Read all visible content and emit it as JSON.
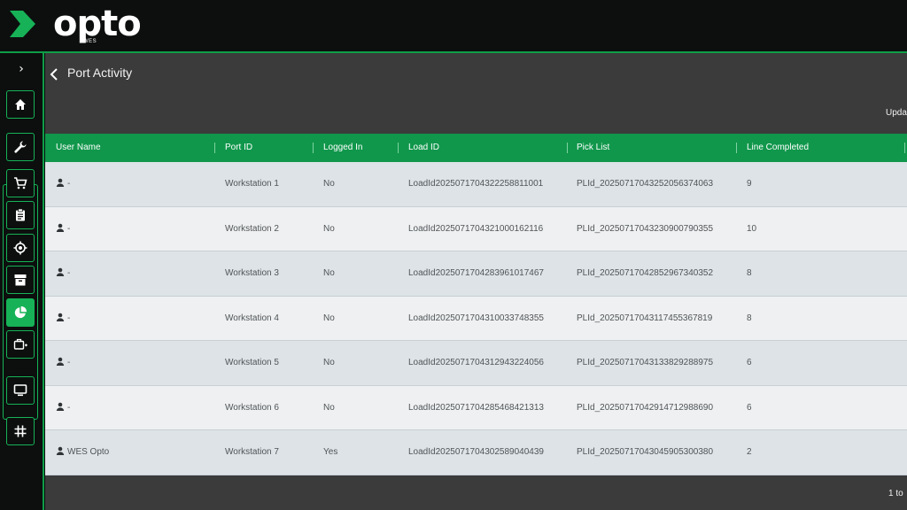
{
  "app": {
    "logo_text": "opto",
    "logo_subtext": "WES",
    "accent": "#17b257",
    "header_green": "#10974b"
  },
  "sidebar": {
    "expand_icon": "chevron-right-icon",
    "items": [
      {
        "name": "home",
        "icon": "home-icon"
      },
      {
        "name": "tools",
        "icon": "wrench-icon"
      },
      {
        "name": "orders",
        "icon": "cart-icon"
      },
      {
        "name": "tasks",
        "icon": "clipboard-icon"
      },
      {
        "name": "locations",
        "icon": "target-icon"
      },
      {
        "name": "storage",
        "icon": "archive-icon"
      },
      {
        "name": "reports",
        "icon": "pie-chart-icon",
        "active": true
      },
      {
        "name": "transfer",
        "icon": "box-arrow-icon"
      },
      {
        "name": "monitor",
        "icon": "monitor-icon"
      },
      {
        "name": "grid",
        "icon": "grid-icon"
      }
    ]
  },
  "page": {
    "title": "Port Activity",
    "update_label": "Upda",
    "footer_text": "1 to"
  },
  "table": {
    "columns": [
      "User Name",
      "Port ID",
      "Logged In",
      "Load ID",
      "Pick List",
      "Line Completed"
    ],
    "rows": [
      {
        "user": "-",
        "port": "Workstation 1",
        "logged_in": "No",
        "load_id": "LoadId2025071704322258811001",
        "pick_list": "PLId_20250717043252056374063",
        "lines": "9"
      },
      {
        "user": "-",
        "port": "Workstation 2",
        "logged_in": "No",
        "load_id": "LoadId2025071704321000162116",
        "pick_list": "PLId_20250717043230900790355",
        "lines": "10"
      },
      {
        "user": "-",
        "port": "Workstation 3",
        "logged_in": "No",
        "load_id": "LoadId2025071704283961017467",
        "pick_list": "PLId_20250717042852967340352",
        "lines": "8"
      },
      {
        "user": "-",
        "port": "Workstation 4",
        "logged_in": "No",
        "load_id": "LoadId2025071704310033748355",
        "pick_list": "PLId_20250717043117455367819",
        "lines": "8"
      },
      {
        "user": "-",
        "port": "Workstation 5",
        "logged_in": "No",
        "load_id": "LoadId2025071704312943224056",
        "pick_list": "PLId_20250717043133829288975",
        "lines": "6"
      },
      {
        "user": "-",
        "port": "Workstation 6",
        "logged_in": "No",
        "load_id": "LoadId2025071704285468421313",
        "pick_list": "PLId_20250717042914712988690",
        "lines": "6"
      },
      {
        "user": "WES Opto",
        "port": "Workstation 7",
        "logged_in": "Yes",
        "load_id": "LoadId2025071704302589040439",
        "pick_list": "PLId_20250717043045905300380",
        "lines": "2"
      }
    ]
  }
}
